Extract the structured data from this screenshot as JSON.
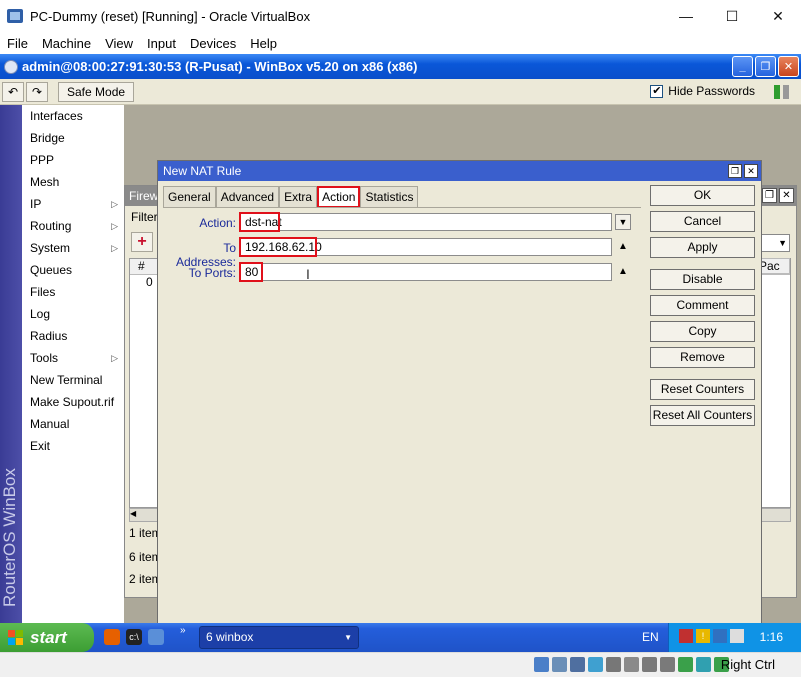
{
  "host": {
    "title": "PC-Dummy (reset) [Running] - Oracle VirtualBox",
    "menu": [
      "File",
      "Machine",
      "View",
      "Input",
      "Devices",
      "Help"
    ],
    "controls": {
      "minimize": "—",
      "maximize": "☐",
      "close": "✕"
    },
    "status_host_key": "Right Ctrl"
  },
  "winbox": {
    "title": "admin@08:00:27:91:30:53 (R-Pusat) - WinBox v5.20 on x86 (x86)",
    "safe_mode": "Safe Mode",
    "hide_passwords_label": "Hide Passwords",
    "hide_passwords_checked": "✔",
    "vertical_brand": "RouterOS WinBox",
    "menu": [
      {
        "label": "Interfaces",
        "arrow": ""
      },
      {
        "label": "Bridge",
        "arrow": ""
      },
      {
        "label": "PPP",
        "arrow": ""
      },
      {
        "label": "Mesh",
        "arrow": ""
      },
      {
        "label": "IP",
        "arrow": "▷"
      },
      {
        "label": "Routing",
        "arrow": "▷"
      },
      {
        "label": "System",
        "arrow": "▷"
      },
      {
        "label": "Queues",
        "arrow": ""
      },
      {
        "label": "Files",
        "arrow": ""
      },
      {
        "label": "Log",
        "arrow": ""
      },
      {
        "label": "Radius",
        "arrow": ""
      },
      {
        "label": "Tools",
        "arrow": "▷"
      },
      {
        "label": "New Terminal",
        "arrow": ""
      },
      {
        "label": "Make Supout.rif",
        "arrow": ""
      },
      {
        "label": "Manual",
        "arrow": ""
      },
      {
        "label": "Exit",
        "arrow": ""
      }
    ]
  },
  "firewall": {
    "title": "Firew",
    "tab": "Filter",
    "col_num": "#",
    "row_num": "0",
    "right_col": "Pac",
    "status1": "1 item",
    "status2": "6 item",
    "status3": "2 item"
  },
  "nat_dialog": {
    "title": "New NAT Rule",
    "tabs": [
      "General",
      "Advanced",
      "Extra",
      "Action",
      "Statistics"
    ],
    "active_tab": "Action",
    "fields": {
      "action_label": "Action:",
      "action_value": "dst-nat",
      "to_addresses_label": "To Addresses:",
      "to_addresses_value": "192.168.62.10",
      "to_ports_label": "To Ports:",
      "to_ports_value": "80"
    },
    "buttons": [
      "OK",
      "Cancel",
      "Apply",
      "Disable",
      "Comment",
      "Copy",
      "Remove",
      "Reset Counters",
      "Reset All Counters"
    ]
  },
  "taskbar": {
    "start": "start",
    "task": "6 winbox",
    "lang": "EN",
    "clock": "1:16"
  },
  "colors": {
    "xp_blue": "#245edb",
    "highlight_red": "#e0101a",
    "label_blue": "#1b2a9a",
    "start_green": "#3c9e33"
  }
}
